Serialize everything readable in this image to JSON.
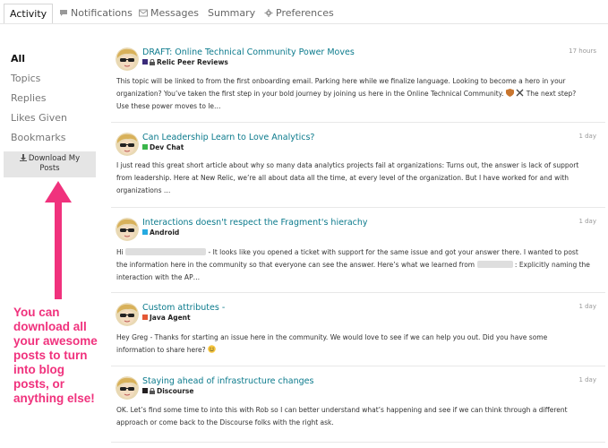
{
  "tabs": [
    {
      "label": "Activity",
      "active": true
    },
    {
      "label": "Notifications",
      "icon": "comment-icon"
    },
    {
      "label": "Messages",
      "icon": "envelope-icon"
    },
    {
      "label": "Summary"
    },
    {
      "label": "Preferences",
      "icon": "gear-icon"
    }
  ],
  "nav": {
    "items": [
      "All",
      "Topics",
      "Replies",
      "Likes Given",
      "Bookmarks"
    ],
    "download_label_line1": "Download My",
    "download_label_line2": "Posts",
    "download_icon": "download-icon"
  },
  "callout": {
    "lines": [
      "You can",
      "download all",
      "your awesome",
      "posts to turn",
      "into blog",
      "posts, or",
      "anything else!"
    ],
    "color": "#f0327d"
  },
  "posts": [
    {
      "title": "DRAFT: Online Technical Community Power Moves",
      "category": "Relic Peer Reviews",
      "category_color": "#3a2b7a",
      "locked": true,
      "time": "17 hours",
      "body": [
        "This topic will be linked to from the first onboarding email. Parking here while we finalize language. Looking to become a hero in your",
        "organization? You’ve taken the first step in your bold journey by joining us here in the Online Technical Community.",
        "The next step?",
        "Use these power moves to le…"
      ]
    },
    {
      "title": "Can Leadership Learn to Love Analytics?",
      "category": "Dev Chat",
      "category_color": "#3ab54a",
      "locked": false,
      "time": "1 day",
      "body": [
        "I just read this great short article about why so many data analytics projects fail at organizations: Turns out, the answer is lack of support",
        "from leadership. Here at New Relic, we’re all about data all the time, at every level of the organization. But I have worked for and with",
        "organizations …"
      ]
    },
    {
      "title": "Interactions doesn't respect the Fragment's hierachy",
      "category": "Android",
      "category_color": "#25aae1",
      "locked": false,
      "time": "1 day",
      "body": [
        "Hi",
        "- It looks like you opened a ticket with support for the same issue and got your answer there. I wanted to post",
        "the information here in the community so that everyone can see the answer. Here’s what we learned from",
        ": Explicitly naming the",
        "interaction with the AP…"
      ]
    },
    {
      "title": "Custom attributes -",
      "category": "Java Agent",
      "category_color": "#e45735",
      "locked": false,
      "time": "1 day",
      "body": [
        "Hey Greg - Thanks for starting an issue here in the community. We would love to see if we can help you out. Did you have some",
        "information to share here?"
      ]
    },
    {
      "title": "Staying ahead of infrastructure changes",
      "category": "Discourse",
      "category_color": "#231f20",
      "locked": true,
      "time": "1 day",
      "body": [
        "OK. Let’s find some time to into this with Rob so I can better understand what’s happening and see if we can think through a different",
        "approach or come back to the Discourse folks with the right ask."
      ]
    }
  ]
}
